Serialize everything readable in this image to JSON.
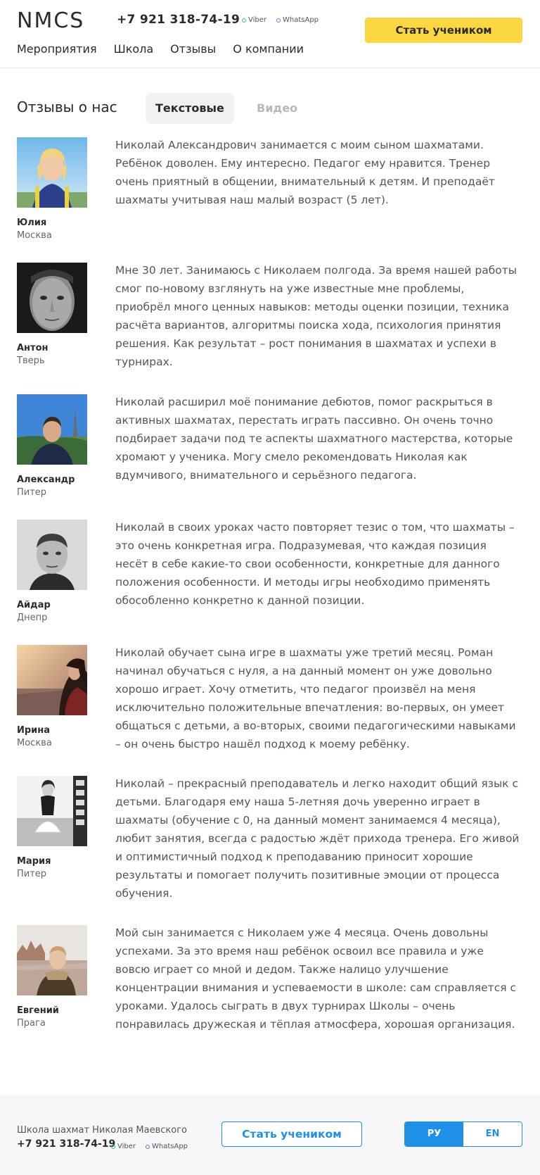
{
  "header": {
    "logo": "NMCS",
    "phone": "+7 921 318-74-19",
    "viber": "Viber",
    "whatsapp": "WhatsApp",
    "cta": "Стать учеником",
    "nav": [
      "Мероприятия",
      "Школа",
      "Отзывы",
      "О компании"
    ]
  },
  "reviews_section": {
    "title": "Отзывы о нас",
    "tabs": [
      {
        "label": "Текстовые",
        "active": true
      },
      {
        "label": "Видео",
        "active": false
      }
    ]
  },
  "reviews": [
    {
      "name": "Юлия",
      "city": "Москва",
      "text": "Николай Александрович занимается с моим сыном шахматами. Ребёнок доволен. Ему интересно. Педагог ему нравится. Тренер очень приятный в общении, внимательный к детям. И преподаёт шахматы учитывая наш малый возраст (5 лет)."
    },
    {
      "name": "Антон",
      "city": "Тверь",
      "text": "Мне 30 лет. Занимаюсь с Николаем полгода. За время нашей работы смог по-новому взглянуть на уже известные мне проблемы, приобрёл много ценных навыков: методы оценки позиции, техника расчёта вариантов, алгоритмы поиска хода, психология принятия решения. Как результат – рост понимания в шахматах и успехи в турнирах."
    },
    {
      "name": "Александр",
      "city": "Питер",
      "text": "Николай расширил моё понимание дебютов, помог раскрыться в активных шахматах, перестать играть пассивно. Он очень точно подбирает задачи под те аспекты шахматного мастерства, которые хромают у ученика. Могу смело рекомендовать Николая как вдумчивого, внимательного и серьёзного педагога."
    },
    {
      "name": "Айдар",
      "city": "Днепр",
      "text": "Николай в своих уроках часто повторяет тезис о том, что шахматы – это очень конкретная игра. Подразумевая, что каждая позиция несёт в себе какие-то свои особенности, конкретные для данного положения особенности. И методы игры необходимо применять обособленно конкретно к данной позиции."
    },
    {
      "name": "Ирина",
      "city": "Москва",
      "text": "Николай обучает сына игре в шахматы уже третий месяц. Роман начинал обучаться с нуля, а на данный момент он уже довольно хорошо играет. Хочу отметить, что педагог произвёл на меня исключительно положительные впечатления: во-первых, он умеет общаться с детьми, а во-вторых, своими педагогическими навыками – он очень быстро нашёл подход к моему ребёнку."
    },
    {
      "name": "Мария",
      "city": "Питер",
      "text": "Николай – прекрасный преподаватель и легко находит общий язык с детьми. Благодаря ему наша 5-летняя дочь уверенно играет в шахматы (обучение с 0, на данный момент занимаемся 4 месяца), любит занятия, всегда с радостью ждёт прихода тренера. Его живой и оптимистичный подход к преподаванию приносит хорошие результаты и помогает получить позитивные эмоции от процесса обучения."
    },
    {
      "name": "Евгений",
      "city": "Прага",
      "text": "Мой сын занимается с Николаем уже 4 месяца. Очень довольны успехами. За это время наш ребёнок освоил все правила и уже вовсю играет со мной и дедом. Также налицо улучшение концентрации внимания и успеваемости в школе: сам справляется с уроками. Удалось сыграть в двух турнирах Школы – очень понравилась дружеская и тёплая атмосфера, хорошая организация."
    }
  ],
  "footer": {
    "school": "Школа шахмат Николая Маевского",
    "phone": "+7 921 318-74-19",
    "viber": "Viber",
    "whatsapp": "WhatsApp",
    "cta": "Стать учеником",
    "languages": [
      {
        "label": "РУ",
        "active": true
      },
      {
        "label": "EN",
        "active": false
      }
    ]
  },
  "colors": {
    "accent_yellow": "#fbd842",
    "accent_blue": "#1e90e8",
    "viber_dot": "#2ec27e",
    "whatsapp_dot": "#7e6bd6"
  }
}
